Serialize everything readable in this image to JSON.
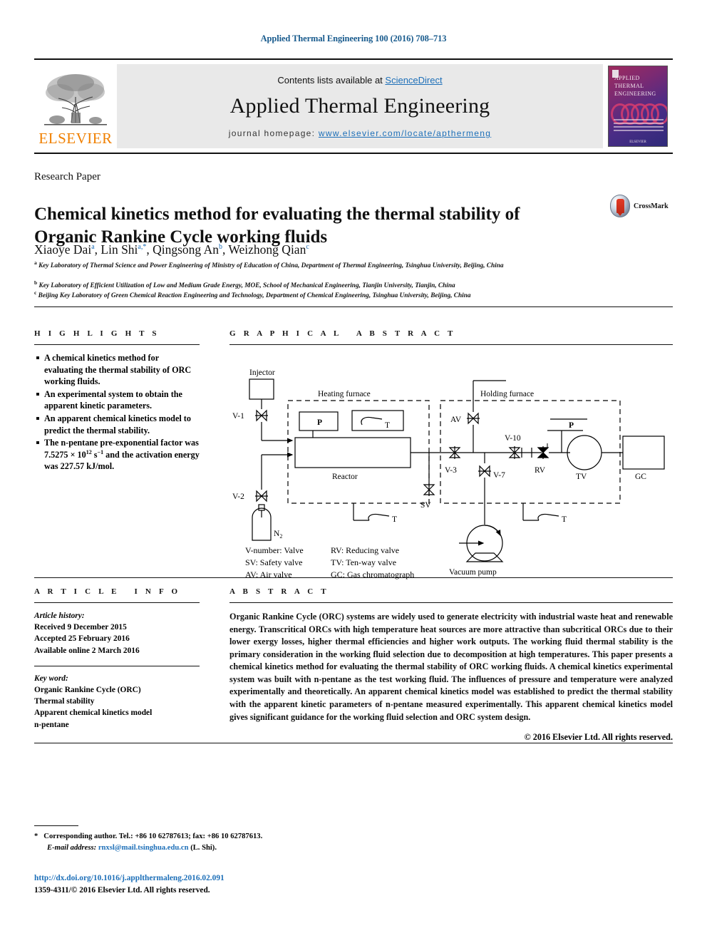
{
  "running_head": "Applied Thermal Engineering 100 (2016) 708–713",
  "masthead": {
    "contents_prefix": "Contents lists available at ",
    "sciencedirect": "ScienceDirect",
    "journal_title": "Applied Thermal Engineering",
    "homepage_prefix": "journal homepage: ",
    "homepage_url": "www.elsevier.com/locate/apthermeng",
    "publisher": "ELSEVIER",
    "cover": {
      "line1": "APPLIED",
      "line2": "THERMAL",
      "line3": "ENGINEERING",
      "footer": "ELSEVIER"
    }
  },
  "article": {
    "type": "Research Paper",
    "title": "Chemical kinetics method for evaluating the thermal stability of Organic Rankine Cycle working fluids",
    "authors": [
      {
        "name": "Xiaoye Dai",
        "marks": "a"
      },
      {
        "name": "Lin Shi",
        "marks": "a,*"
      },
      {
        "name": "Qingsong An",
        "marks": "b"
      },
      {
        "name": "Weizhong Qian",
        "marks": "c"
      }
    ],
    "affiliations": [
      {
        "mark": "a",
        "text": "Key Laboratory of Thermal Science and Power Engineering of Ministry of Education of China, Department of Thermal Engineering, Tsinghua University, Beijing, China"
      },
      {
        "mark": "b",
        "text": "Key Laboratory of Efficient Utilization of Low and Medium Grade Energy, MOE, School of Mechanical Engineering, Tianjin University, Tianjin, China"
      },
      {
        "mark": "c",
        "text": "Beijing Key Laboratory of Green Chemical Reaction Engineering and Technology, Department of Chemical Engineering, Tsinghua University, Beijing, China"
      }
    ],
    "crossmark_label": "CrossMark"
  },
  "highlights": {
    "heading": "HIGHLIGHTS",
    "items": [
      "A chemical kinetics method for evaluating the thermal stability of ORC working fluids.",
      "An experimental system to obtain the apparent kinetic parameters.",
      "An apparent chemical kinetics model to predict the thermal stability.",
      "The n-pentane pre-exponential factor was 7.5275 × 10^12 s^-1 and the activation energy was 227.57 kJ/mol."
    ],
    "item4_parts": {
      "a": "The n-pentane pre-exponential factor was 7.5275 × 10",
      "exp1": "12",
      "b": " s",
      "exp2": "−1",
      "c": " and the activation energy was 227.57 kJ/mol."
    }
  },
  "graphical_abstract": {
    "heading": "GRAPHICAL ABSTRACT",
    "labels": {
      "injector": "Injector",
      "heating_furnace": "Heating furnace",
      "holding_furnace": "Holding furnace",
      "reactor": "Reactor",
      "v1": "V-1",
      "v2": "V-2",
      "v3": "V-3",
      "v7": "V-7",
      "v10": "V-10",
      "av": "AV",
      "sv": "SV",
      "rv": "RV",
      "tv": "TV",
      "gc": "GC",
      "p1": "P",
      "p2": "P",
      "t1": "T",
      "t2": "T",
      "t3": "T",
      "n2": "N₂",
      "vacuum_pump": "Vacuum pump"
    },
    "legend": [
      [
        "V-number: Valve",
        "RV: Reducing valve"
      ],
      [
        "SV: Safety valve",
        "TV: Ten-way valve"
      ],
      [
        "AV: Air valve",
        "GC: Gas chromatograph"
      ]
    ]
  },
  "article_info": {
    "heading": "ARTICLE INFO",
    "history_label": "Article history:",
    "history": [
      "Received 9 December 2015",
      "Accepted 25 February 2016",
      "Available online 2 March 2016"
    ],
    "keyword_label": "Key word:",
    "keywords": [
      "Organic Rankine Cycle (ORC)",
      "Thermal stability",
      "Apparent chemical kinetics model",
      "n-pentane"
    ]
  },
  "abstract": {
    "heading": "ABSTRACT",
    "text": "Organic Rankine Cycle (ORC) systems are widely used to generate electricity with industrial waste heat and renewable energy. Transcritical ORCs with high temperature heat sources are more attractive than subcritical ORCs due to their lower exergy losses, higher thermal efficiencies and higher work outputs. The working fluid thermal stability is the primary consideration in the working fluid selection due to decomposition at high temperatures. This paper presents a chemical kinetics method for evaluating the thermal stability of ORC working fluids. A chemical kinetics experimental system was built with n-pentane as the test working fluid. The influences of pressure and temperature were analyzed experimentally and theoretically. An apparent chemical kinetics model was established to predict the thermal stability with the apparent kinetic parameters of n-pentane measured experimentally. This apparent chemical kinetics model gives significant guidance for the working fluid selection and ORC system design.",
    "copyright": "© 2016 Elsevier Ltd. All rights reserved."
  },
  "footer": {
    "corresponding_star": "*",
    "corresponding": "Corresponding author. Tel.: +86 10 62787613; fax: +86 10 62787613.",
    "email_label": "E-mail address:",
    "email": "rnxsl@mail.tsinghua.edu.cn",
    "email_person": "(L. Shi).",
    "doi": "http://dx.doi.org/10.1016/j.applthermaleng.2016.02.091",
    "issn": "1359-4311/© 2016 Elsevier Ltd. All rights reserved."
  },
  "colors": {
    "link": "#1d6fb8",
    "elsevier_orange": "#f08000",
    "rule": "#111111"
  }
}
